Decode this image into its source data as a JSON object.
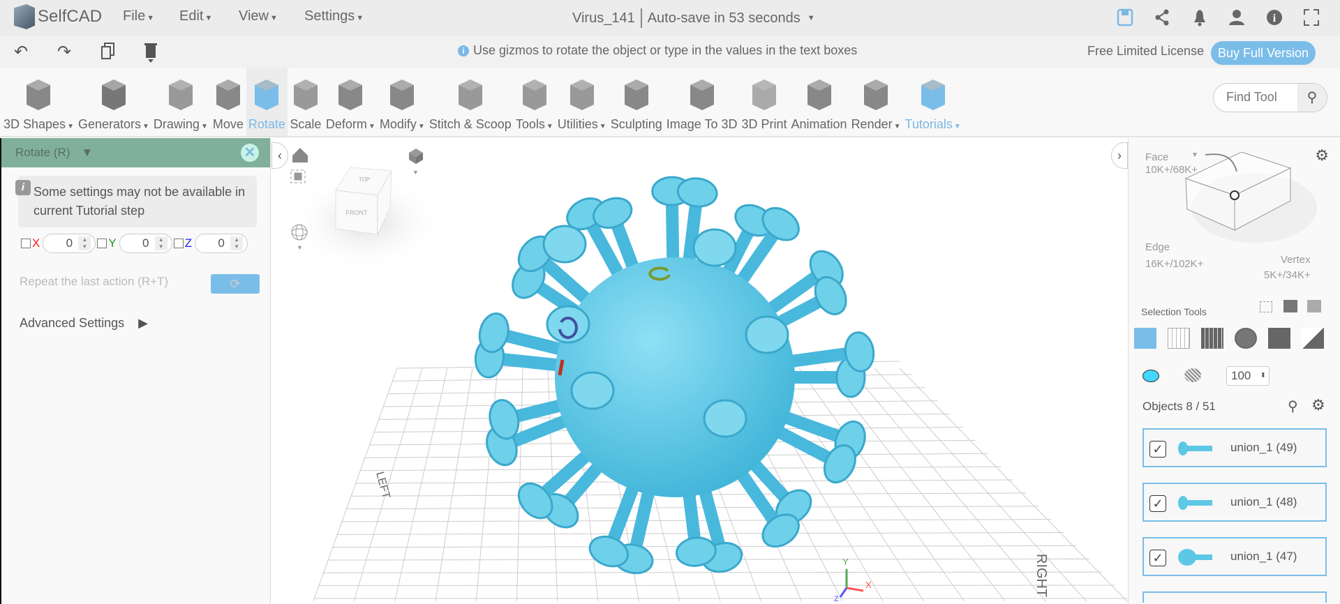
{
  "app": {
    "name": "SelfCAD"
  },
  "menu": [
    {
      "label": "File"
    },
    {
      "label": "Edit"
    },
    {
      "label": "View"
    },
    {
      "label": "Settings"
    }
  ],
  "document": {
    "title": "Virus_141",
    "autosave": "Auto-save in 53 seconds"
  },
  "top_icons": [
    "save-icon",
    "share-icon",
    "bell-icon",
    "user-icon",
    "info-icon",
    "fullscreen-icon"
  ],
  "hint": "Use gizmos to rotate the object or type in the values in the text boxes",
  "license": {
    "text": "Free Limited License",
    "buy_label": "Buy Full Version"
  },
  "toolbar": [
    {
      "label": "3D Shapes",
      "dropdown": true
    },
    {
      "label": "Generators",
      "dropdown": true
    },
    {
      "label": "Drawing",
      "dropdown": true
    },
    {
      "label": "Move"
    },
    {
      "label": "Rotate",
      "active": true
    },
    {
      "label": "Scale"
    },
    {
      "label": "Deform",
      "dropdown": true
    },
    {
      "label": "Modify",
      "dropdown": true
    },
    {
      "label": "Stitch & Scoop"
    },
    {
      "label": "Tools",
      "dropdown": true
    },
    {
      "label": "Utilities",
      "dropdown": true
    },
    {
      "label": "Sculpting"
    },
    {
      "label": "Image To 3D"
    },
    {
      "label": "3D Print"
    },
    {
      "label": "Animation"
    },
    {
      "label": "Render",
      "dropdown": true
    },
    {
      "label": "Tutorials",
      "dropdown": true
    }
  ],
  "find_tool": {
    "placeholder": "Find Tool"
  },
  "left_panel": {
    "title": "Rotate (R)",
    "notice": "Some settings may not be available in current Tutorial step",
    "axes": [
      {
        "label": "X",
        "value": "0",
        "color": "#ff2020"
      },
      {
        "label": "Y",
        "value": "0",
        "color": "#1a9a1a"
      },
      {
        "label": "Z",
        "value": "0",
        "color": "#2020ff"
      }
    ],
    "repeat_label": "Repeat the last action (R+T)",
    "advanced_label": "Advanced Settings"
  },
  "viewport": {
    "cube_top": "TOP",
    "cube_front": "FRONT",
    "grid_left": "LEFT",
    "grid_right": "RIGHT",
    "axis_x": "X",
    "axis_y": "Y",
    "axis_z": "Z",
    "object_color": "#5cc8e6"
  },
  "right_panel": {
    "face_label": "Face",
    "face_count": "10K+/68K+",
    "edge_label": "Edge",
    "edge_count": "16K+/102K+",
    "vertex_label": "Vertex",
    "vertex_count": "5K+/34K+",
    "selection_tools": "Selection Tools",
    "color_value": "#44d6ff",
    "opacity": "100",
    "objects_label": "Objects 8 / 51",
    "objects": [
      {
        "name": "union_1 (49)"
      },
      {
        "name": "union_1 (48)"
      },
      {
        "name": "union_1 (47)"
      }
    ]
  }
}
